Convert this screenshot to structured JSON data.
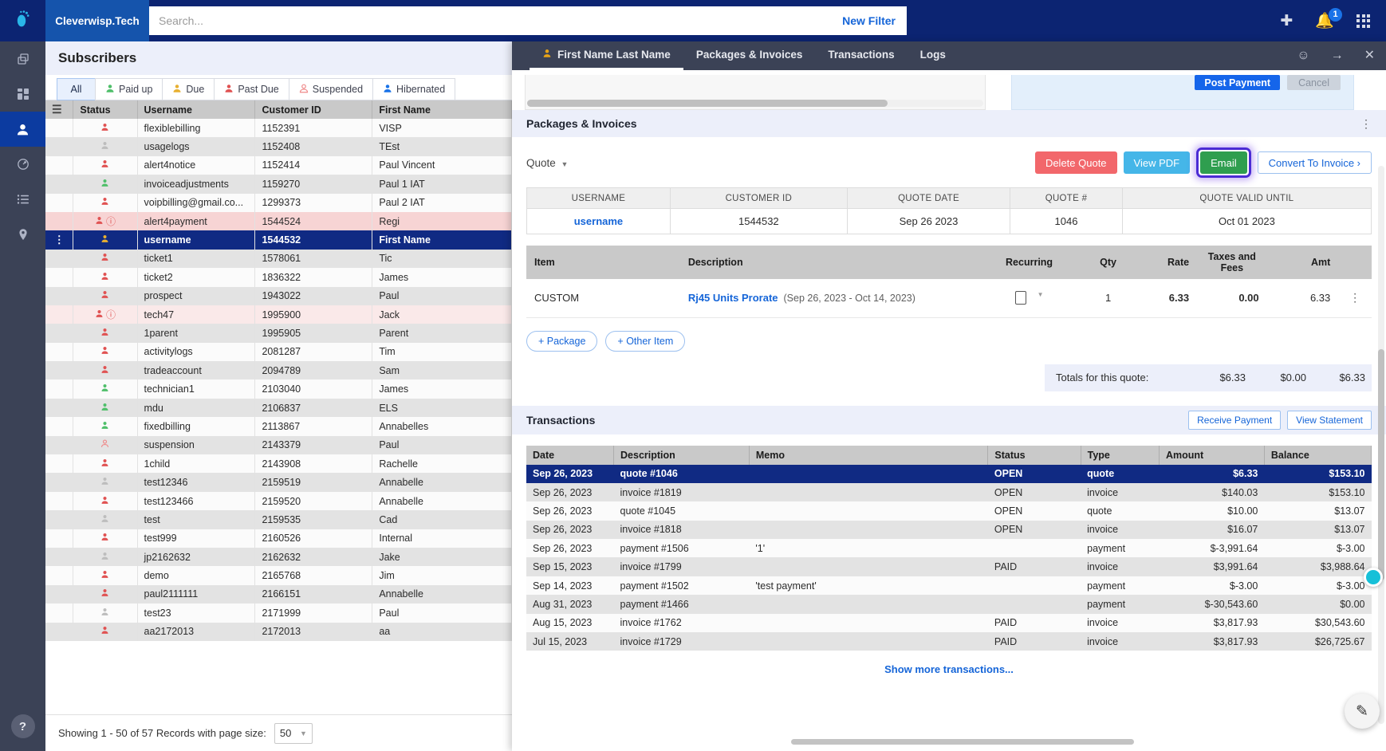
{
  "topbar": {
    "logo_icon": "footprint-logo-icon",
    "brand": "Cleverwisp.Tech",
    "search_placeholder": "Search...",
    "search_value": "",
    "new_filter": "New Filter",
    "plus_icon": "plus-icon",
    "bell_icon": "bell-icon",
    "notification_count": "1",
    "apps_icon": "apps-grid-icon"
  },
  "rail": {
    "items": [
      {
        "icon": "copy-layers-icon",
        "active": false
      },
      {
        "icon": "dashboard-grid-icon",
        "active": false
      },
      {
        "icon": "person-icon",
        "active": true
      },
      {
        "icon": "speedometer-icon",
        "active": false
      },
      {
        "icon": "list-icon",
        "active": false
      },
      {
        "icon": "map-pin-icon",
        "active": false
      }
    ],
    "help_label": "?"
  },
  "subscribers": {
    "title": "Subscribers",
    "tabs": [
      {
        "label": "All",
        "icon": "",
        "active": true
      },
      {
        "label": "Paid up",
        "icon": "person-green-icon",
        "active": false
      },
      {
        "label": "Due",
        "icon": "person-amber-icon",
        "active": false
      },
      {
        "label": "Past Due",
        "icon": "person-red-icon",
        "active": false
      },
      {
        "label": "Suspended",
        "icon": "person-outline-icon",
        "active": false
      },
      {
        "label": "Hibernated",
        "icon": "person-blue-icon",
        "active": false
      }
    ],
    "columns": [
      "",
      "Status",
      "Username",
      "Customer ID",
      "First Name"
    ],
    "rows": [
      {
        "status": "red",
        "warn": false,
        "username": "flexiblebilling",
        "cid": "1152391",
        "first": "VISP",
        "state": ""
      },
      {
        "status": "grey",
        "warn": false,
        "username": "usagelogs",
        "cid": "1152408",
        "first": "TEst",
        "state": ""
      },
      {
        "status": "red",
        "warn": false,
        "username": "alert4notice",
        "cid": "1152414",
        "first": "Paul Vincent",
        "state": ""
      },
      {
        "status": "green",
        "warn": false,
        "username": "invoiceadjustments",
        "cid": "1159270",
        "first": "Paul 1 IAT",
        "state": ""
      },
      {
        "status": "red",
        "warn": false,
        "username": "voipbilling@gmail.co...",
        "cid": "1299373",
        "first": "Paul 2 IAT",
        "state": ""
      },
      {
        "status": "red",
        "warn": true,
        "username": "alert4payment",
        "cid": "1544524",
        "first": "Regi",
        "state": "alert"
      },
      {
        "status": "amber",
        "warn": false,
        "username": "username",
        "cid": "1544532",
        "first": "First Name",
        "state": "sel"
      },
      {
        "status": "red",
        "warn": false,
        "username": "ticket1",
        "cid": "1578061",
        "first": "Tic",
        "state": ""
      },
      {
        "status": "red",
        "warn": false,
        "username": "ticket2",
        "cid": "1836322",
        "first": "James",
        "state": ""
      },
      {
        "status": "red",
        "warn": false,
        "username": "prospect",
        "cid": "1943022",
        "first": "Paul",
        "state": ""
      },
      {
        "status": "red",
        "warn": true,
        "username": "tech47",
        "cid": "1995900",
        "first": "Jack",
        "state": "alert2"
      },
      {
        "status": "red",
        "warn": false,
        "username": "1parent",
        "cid": "1995905",
        "first": "Parent",
        "state": ""
      },
      {
        "status": "red",
        "warn": false,
        "username": "activitylogs",
        "cid": "2081287",
        "first": "Tim",
        "state": ""
      },
      {
        "status": "red",
        "warn": false,
        "username": "tradeaccount",
        "cid": "2094789",
        "first": "Sam",
        "state": ""
      },
      {
        "status": "green",
        "warn": false,
        "username": "technician1",
        "cid": "2103040",
        "first": "James",
        "state": ""
      },
      {
        "status": "green",
        "warn": false,
        "username": "mdu",
        "cid": "2106837",
        "first": "ELS",
        "state": ""
      },
      {
        "status": "green",
        "warn": false,
        "username": "fixedbilling",
        "cid": "2113867",
        "first": "Annabelles",
        "state": ""
      },
      {
        "status": "outline",
        "warn": false,
        "username": "suspension",
        "cid": "2143379",
        "first": "Paul",
        "state": ""
      },
      {
        "status": "red",
        "warn": false,
        "username": "1child",
        "cid": "2143908",
        "first": "Rachelle",
        "state": ""
      },
      {
        "status": "grey",
        "warn": false,
        "username": "test12346",
        "cid": "2159519",
        "first": "Annabelle",
        "state": ""
      },
      {
        "status": "red",
        "warn": false,
        "username": "test123466",
        "cid": "2159520",
        "first": "Annabelle",
        "state": ""
      },
      {
        "status": "grey",
        "warn": false,
        "username": "test",
        "cid": "2159535",
        "first": "Cad",
        "state": ""
      },
      {
        "status": "red",
        "warn": false,
        "username": "test999",
        "cid": "2160526",
        "first": "Internal",
        "state": ""
      },
      {
        "status": "grey",
        "warn": false,
        "username": "jp2162632",
        "cid": "2162632",
        "first": "Jake",
        "state": ""
      },
      {
        "status": "red",
        "warn": false,
        "username": "demo",
        "cid": "2165768",
        "first": "Jim",
        "state": ""
      },
      {
        "status": "red",
        "warn": false,
        "username": "paul2111111",
        "cid": "2166151",
        "first": "Annabelle",
        "state": ""
      },
      {
        "status": "grey",
        "warn": false,
        "username": "test23",
        "cid": "2171999",
        "first": "Paul",
        "state": ""
      },
      {
        "status": "red",
        "warn": false,
        "username": "aa2172013",
        "cid": "2172013",
        "first": "aa",
        "state": ""
      }
    ],
    "footer_text": "Showing 1 - 50 of 57 Records with page size:",
    "page_size": "50"
  },
  "detail": {
    "tabs": [
      {
        "label": "First Name Last Name",
        "icon": "person-amber-icon",
        "active": true
      },
      {
        "label": "Packages & Invoices",
        "icon": "",
        "active": false
      },
      {
        "label": "Transactions",
        "icon": "",
        "active": false
      },
      {
        "label": "Logs",
        "icon": "",
        "active": false
      }
    ],
    "tools": [
      {
        "icon": "smiley-icon"
      },
      {
        "icon": "arrow-right-icon"
      },
      {
        "icon": "close-icon"
      }
    ],
    "partial": {
      "post_payment": "Post Payment",
      "cancel": "Cancel"
    },
    "packages": {
      "title": "Packages & Invoices",
      "menu_icon": "vertical-dots-icon",
      "quote_selector": "Quote",
      "buttons": {
        "delete_quote": "Delete Quote",
        "view_pdf": "View PDF",
        "email": "Email",
        "convert": "Convert To Invoice ›"
      },
      "highlight_color": "#4b2bd4",
      "meta_columns": [
        "USERNAME",
        "CUSTOMER ID",
        "QUOTE DATE",
        "QUOTE #",
        "QUOTE VALID UNTIL"
      ],
      "meta_values": [
        "username",
        "1544532",
        "Sep 26 2023",
        "1046",
        "Oct 01 2023"
      ],
      "item_columns": [
        "Item",
        "Description",
        "Recurring",
        "Qty",
        "Rate",
        "Taxes and Fees",
        "Amt"
      ],
      "items": [
        {
          "item": "CUSTOM",
          "description": "Rj45 Units Prorate",
          "period": "(Sep 26, 2023 - Oct 14, 2023)",
          "recurring": false,
          "qty": "1",
          "rate": "6.33",
          "taxes": "0.00",
          "amt": "6.33",
          "row_menu_icon": "vertical-dots-icon"
        }
      ],
      "add_package": "+ Package",
      "add_other": "+ Other Item",
      "totals_label": "Totals for this quote:",
      "totals": [
        "$6.33",
        "$0.00",
        "$6.33"
      ]
    },
    "transactions": {
      "title": "Transactions",
      "receive_payment": "Receive Payment",
      "view_statement": "View Statement",
      "columns": [
        "Date",
        "Description",
        "Memo",
        "Status",
        "Type",
        "Amount",
        "Balance"
      ],
      "rows": [
        {
          "date": "Sep 26, 2023",
          "desc": "quote #1046",
          "memo": "",
          "status": "OPEN",
          "type": "quote",
          "amount": "$6.33",
          "balance": "$153.10",
          "selected": true
        },
        {
          "date": "Sep 26, 2023",
          "desc": "invoice #1819",
          "memo": "",
          "status": "OPEN",
          "type": "invoice",
          "amount": "$140.03",
          "balance": "$153.10",
          "selected": false
        },
        {
          "date": "Sep 26, 2023",
          "desc": "quote #1045",
          "memo": "",
          "status": "OPEN",
          "type": "quote",
          "amount": "$10.00",
          "balance": "$13.07",
          "selected": false
        },
        {
          "date": "Sep 26, 2023",
          "desc": "invoice #1818",
          "memo": "",
          "status": "OPEN",
          "type": "invoice",
          "amount": "$16.07",
          "balance": "$13.07",
          "selected": false
        },
        {
          "date": "Sep 26, 2023",
          "desc": "payment #1506",
          "memo": "'1'",
          "status": "",
          "type": "payment",
          "amount": "$-3,991.64",
          "balance": "$-3.00",
          "selected": false
        },
        {
          "date": "Sep 15, 2023",
          "desc": "invoice #1799",
          "memo": "",
          "status": "PAID",
          "type": "invoice",
          "amount": "$3,991.64",
          "balance": "$3,988.64",
          "selected": false
        },
        {
          "date": "Sep 14, 2023",
          "desc": "payment #1502",
          "memo": "'test payment'",
          "status": "",
          "type": "payment",
          "amount": "$-3.00",
          "balance": "$-3.00",
          "selected": false
        },
        {
          "date": "Aug 31, 2023",
          "desc": "payment #1466",
          "memo": "",
          "status": "",
          "type": "payment",
          "amount": "$-30,543.60",
          "balance": "$0.00",
          "selected": false
        },
        {
          "date": "Aug 15, 2023",
          "desc": "invoice #1762",
          "memo": "",
          "status": "PAID",
          "type": "invoice",
          "amount": "$3,817.93",
          "balance": "$30,543.60",
          "selected": false
        },
        {
          "date": "Jul 15, 2023",
          "desc": "invoice #1729",
          "memo": "",
          "status": "PAID",
          "type": "invoice",
          "amount": "$3,817.93",
          "balance": "$26,725.67",
          "selected": false
        }
      ],
      "show_more": "Show more transactions..."
    }
  },
  "widgets": {
    "teal_icon": "chat-bubble-icon",
    "pen_icon": "pen-icon"
  }
}
